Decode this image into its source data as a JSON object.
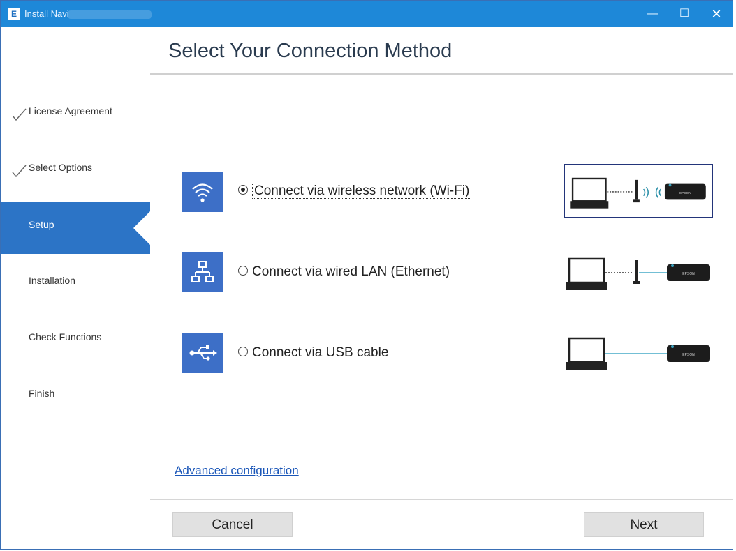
{
  "window": {
    "title": "Install Navi",
    "app_icon_letter": "E",
    "controls": {
      "minimize": "—",
      "maximize": "☐",
      "close": "✕"
    },
    "titlebar_color": "#1e88d8"
  },
  "sidebar": {
    "items": [
      {
        "label": "License Agreement",
        "state": "done"
      },
      {
        "label": "Select Options",
        "state": "done"
      },
      {
        "label": "Setup",
        "state": "active"
      },
      {
        "label": "Installation",
        "state": "pending"
      },
      {
        "label": "Check Functions",
        "state": "pending"
      },
      {
        "label": "Finish",
        "state": "pending"
      }
    ],
    "active_color": "#2c74c6"
  },
  "main": {
    "title": "Select Your Connection Method",
    "options": [
      {
        "label": "Connect via wireless network (Wi-Fi)",
        "selected": true,
        "icon": "wifi-icon"
      },
      {
        "label": "Connect via wired LAN (Ethernet)",
        "selected": false,
        "icon": "network-icon"
      },
      {
        "label": "Connect via USB cable",
        "selected": false,
        "icon": "usb-icon"
      }
    ],
    "device_brand": "EPSON",
    "advanced_link": "Advanced configuration"
  },
  "footer": {
    "cancel_label": "Cancel",
    "next_label": "Next"
  }
}
